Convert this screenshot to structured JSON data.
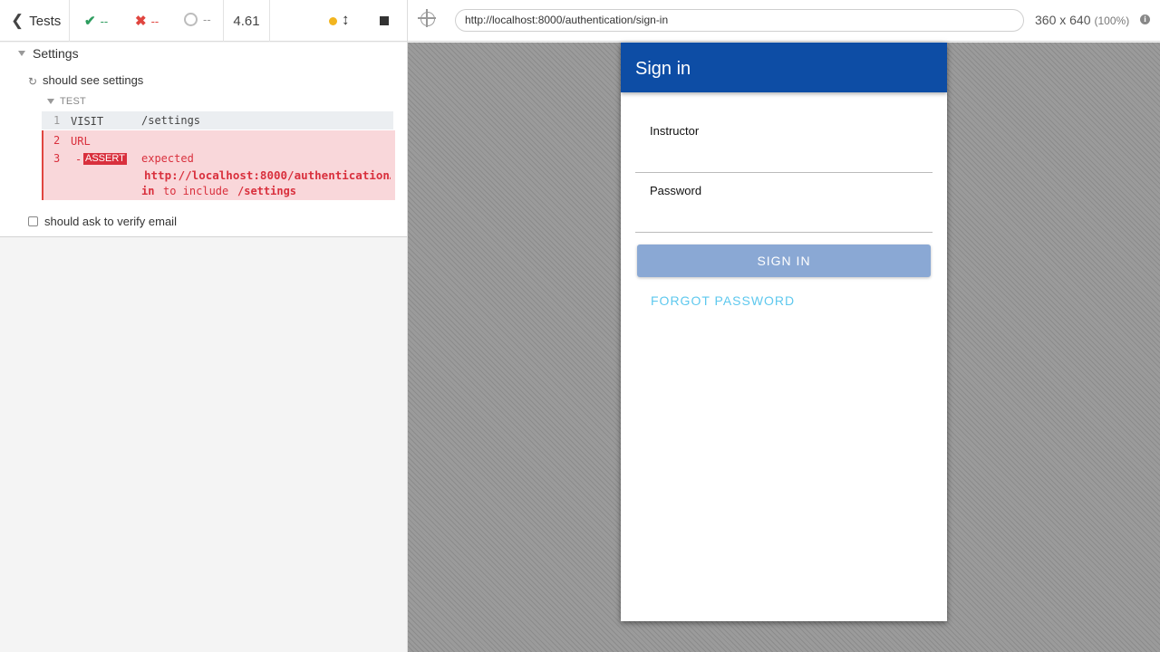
{
  "reporter": {
    "back_label": "Tests",
    "stats": {
      "passed": "--",
      "failed": "--",
      "pending": "--"
    },
    "duration": "4.61",
    "tree": {
      "suite_title": "Settings",
      "tests": [
        {
          "title": "should see settings",
          "state": "running",
          "section_label": "TEST",
          "commands": [
            {
              "num": "1",
              "name": "VISIT",
              "message": "/settings"
            },
            {
              "num": "2",
              "name": "URL",
              "message": ""
            },
            {
              "num": "3",
              "prefix": "-",
              "name": "ASSERT",
              "expected_word": "expected",
              "actual": "http://localhost:8000/authentication…",
              "in_word": "in",
              "to_include": "to include",
              "expected_value": "/settings"
            }
          ]
        },
        {
          "title": "should ask to verify email",
          "state": "pending"
        }
      ]
    }
  },
  "aut": {
    "url": "http://localhost:8000/authentication/sign-in",
    "viewport": "360 x 640",
    "viewport_scale": "(100%)",
    "app": {
      "title": "Sign in",
      "fields": [
        {
          "label": "Instructor",
          "value": ""
        },
        {
          "label": "Password",
          "value": ""
        }
      ],
      "sign_in_label": "SIGN IN",
      "forgot_label": "FORGOT PASSWORD",
      "colors": {
        "app_bar": "#0d4da5",
        "button": "#8aa8d4",
        "link": "#5ec8ee"
      }
    }
  },
  "icons": {
    "back": "chevron-left-icon",
    "passed": "checkmark-icon",
    "failed": "x-icon",
    "pending": "ring-icon",
    "running": "spinner-icon",
    "selector": "crosshair-icon",
    "info": "info-icon"
  }
}
